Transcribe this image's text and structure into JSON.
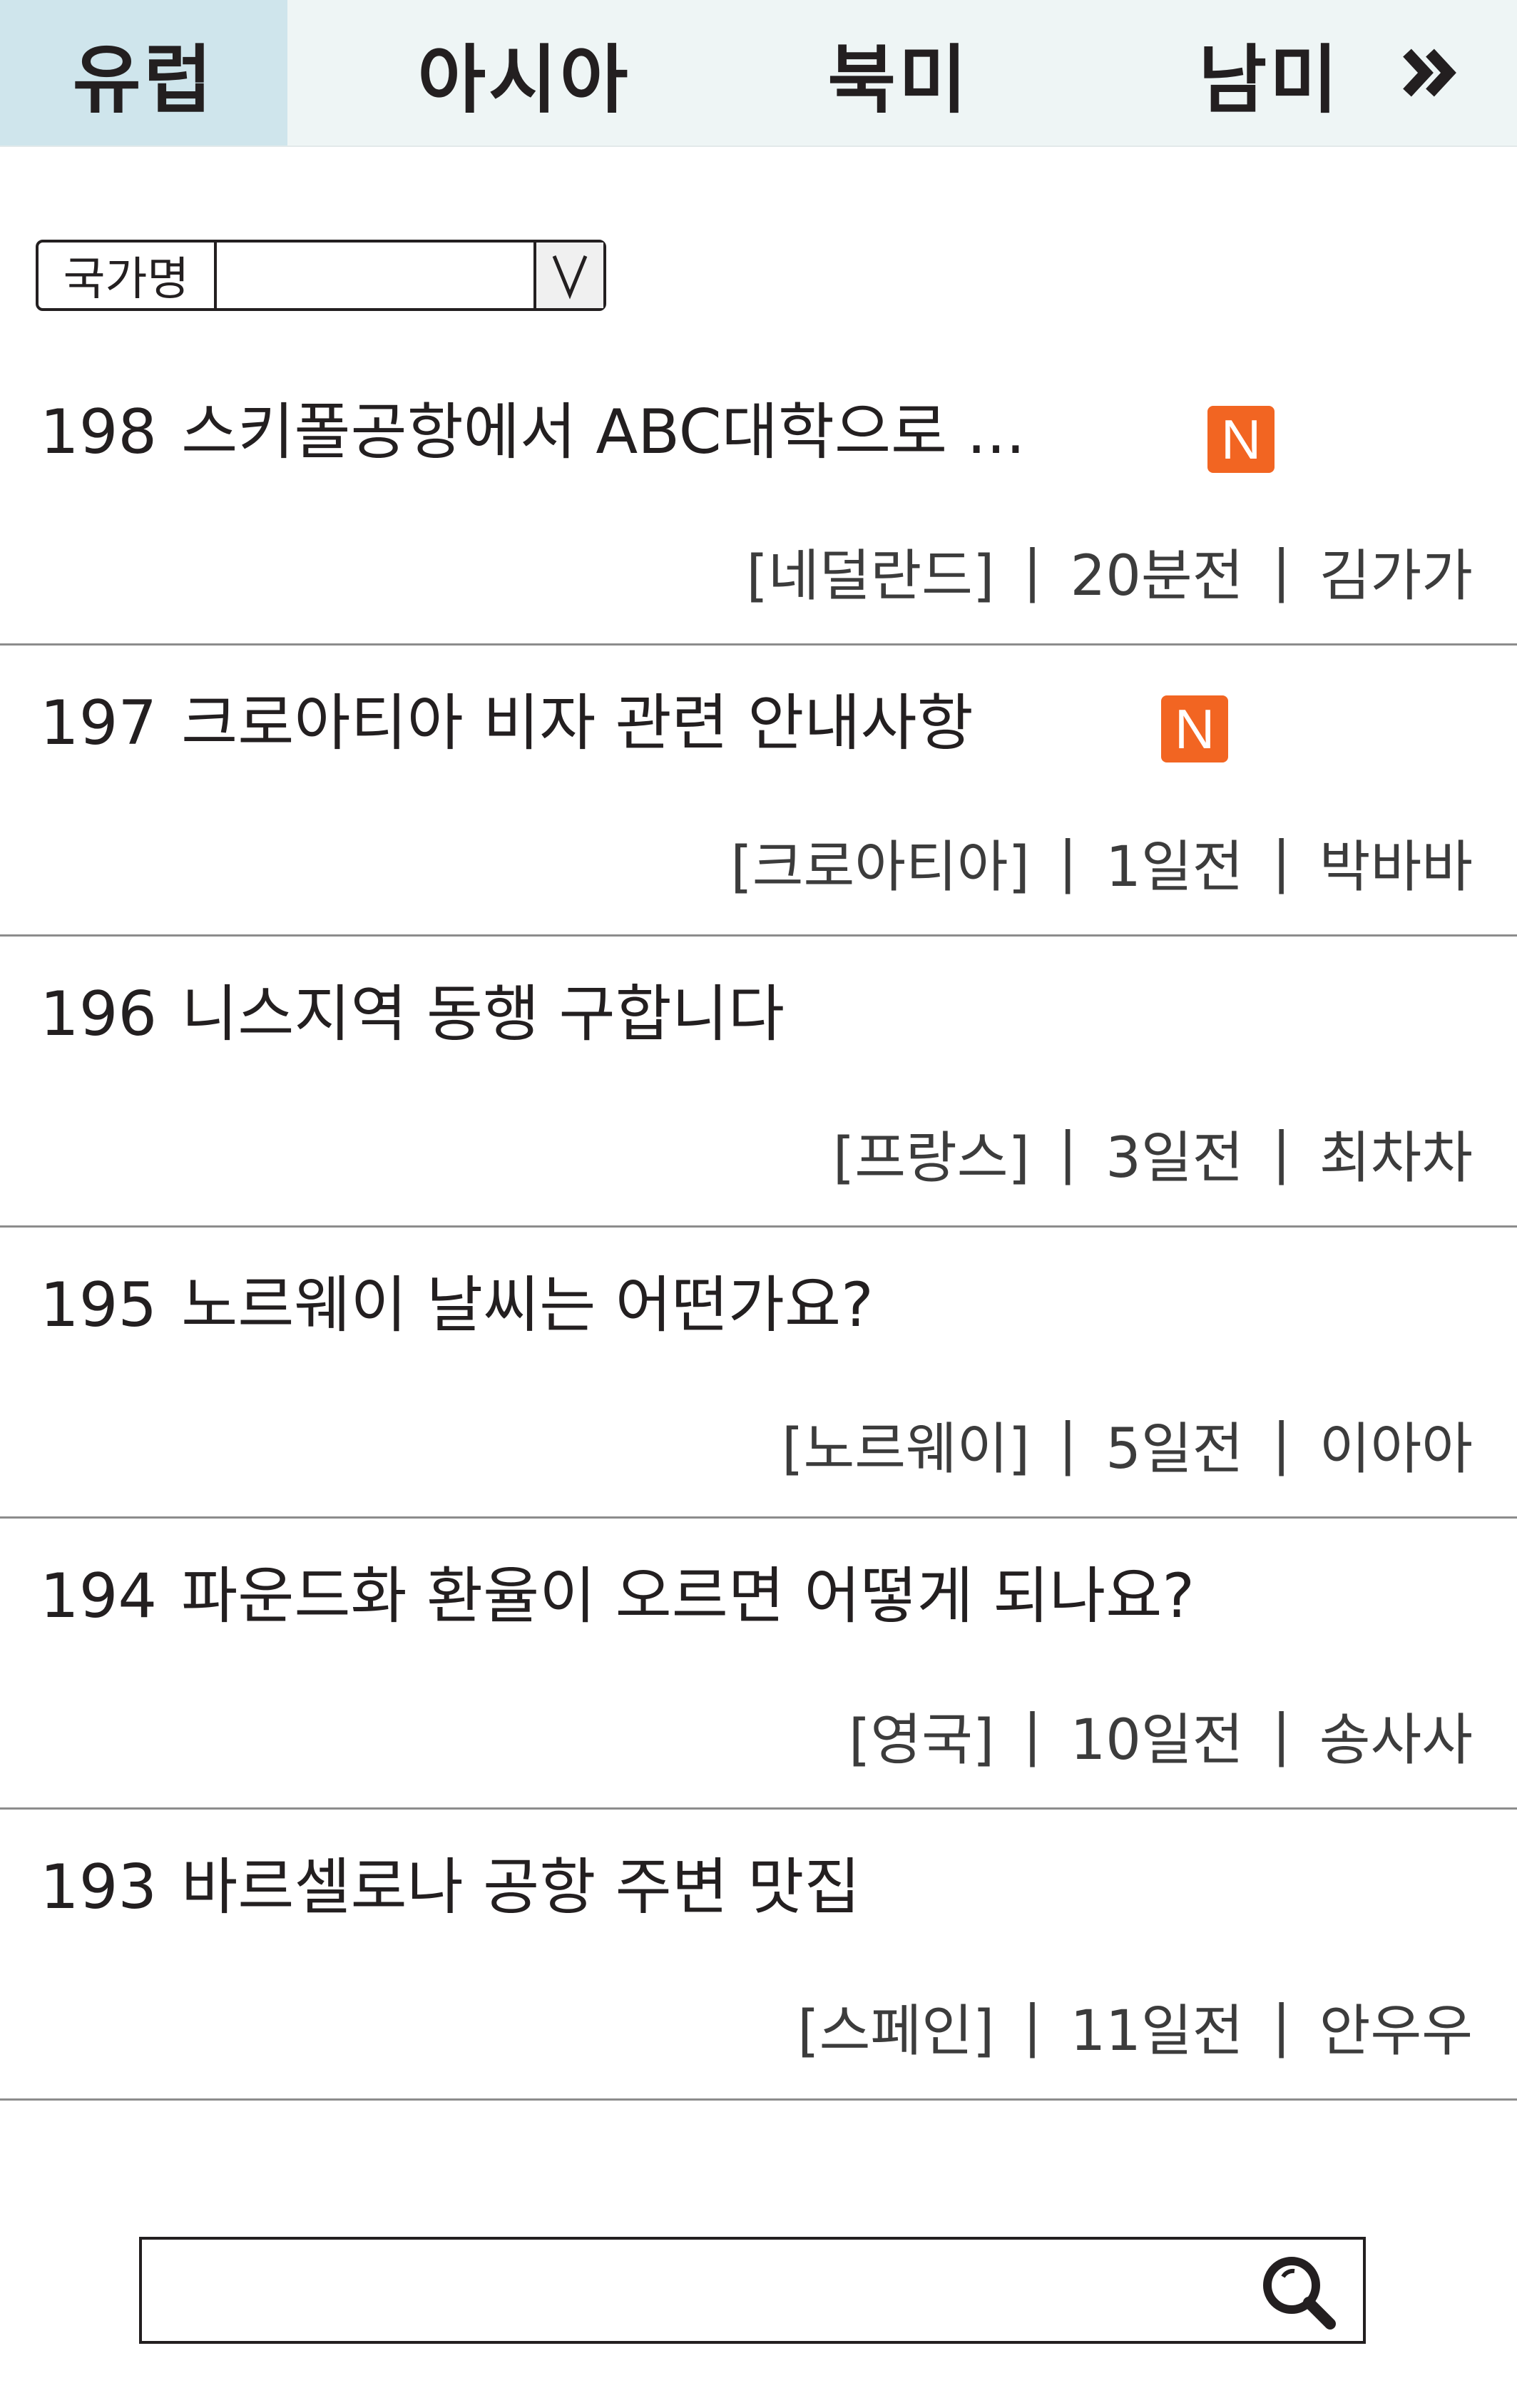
{
  "tabs": [
    {
      "label": "유럽",
      "active": true
    },
    {
      "label": "아시아",
      "active": false
    },
    {
      "label": "북미",
      "active": false
    },
    {
      "label": "남미",
      "active": false
    }
  ],
  "tab_more_icon": "double-chevron-right-icon",
  "country_filter": {
    "label": "국가명",
    "value": "",
    "arrow_glyph": "V"
  },
  "posts": [
    {
      "number": "198",
      "title": "스키폴공항에서 ABC대학으로 ...",
      "is_new": true,
      "badge": "N",
      "country": "[네덜란드]",
      "time": "20분전",
      "author": "김가가"
    },
    {
      "number": "197",
      "title": "크로아티아 비자 관련 안내사항",
      "is_new": true,
      "badge": "N",
      "country": "[크로아티아]",
      "time": "1일전",
      "author": "박바바"
    },
    {
      "number": "196",
      "title": "니스지역 동행 구합니다",
      "is_new": false,
      "country": "[프랑스]",
      "time": "3일전",
      "author": "최차차"
    },
    {
      "number": "195",
      "title": "노르웨이 날씨는 어떤가요?",
      "is_new": false,
      "country": "[노르웨이]",
      "time": "5일전",
      "author": "이아아"
    },
    {
      "number": "194",
      "title": "파운드화 환율이 오르면 어떻게 되나요?",
      "is_new": false,
      "country": "[영국]",
      "time": "10일전",
      "author": "송사사"
    },
    {
      "number": "193",
      "title": "바르셀로나 공항 주변 맛집",
      "is_new": false,
      "country": "[스페인]",
      "time": "11일전",
      "author": "안우우"
    }
  ],
  "meta_separator": "|",
  "search": {
    "placeholder": "",
    "value": "",
    "icon": "search-icon"
  },
  "colors": {
    "tab_bar": "#eef5f5",
    "active_tab": "#cfe5ec",
    "new_badge": "#f26522",
    "text": "#231f20",
    "divider": "#8c8c8c"
  }
}
